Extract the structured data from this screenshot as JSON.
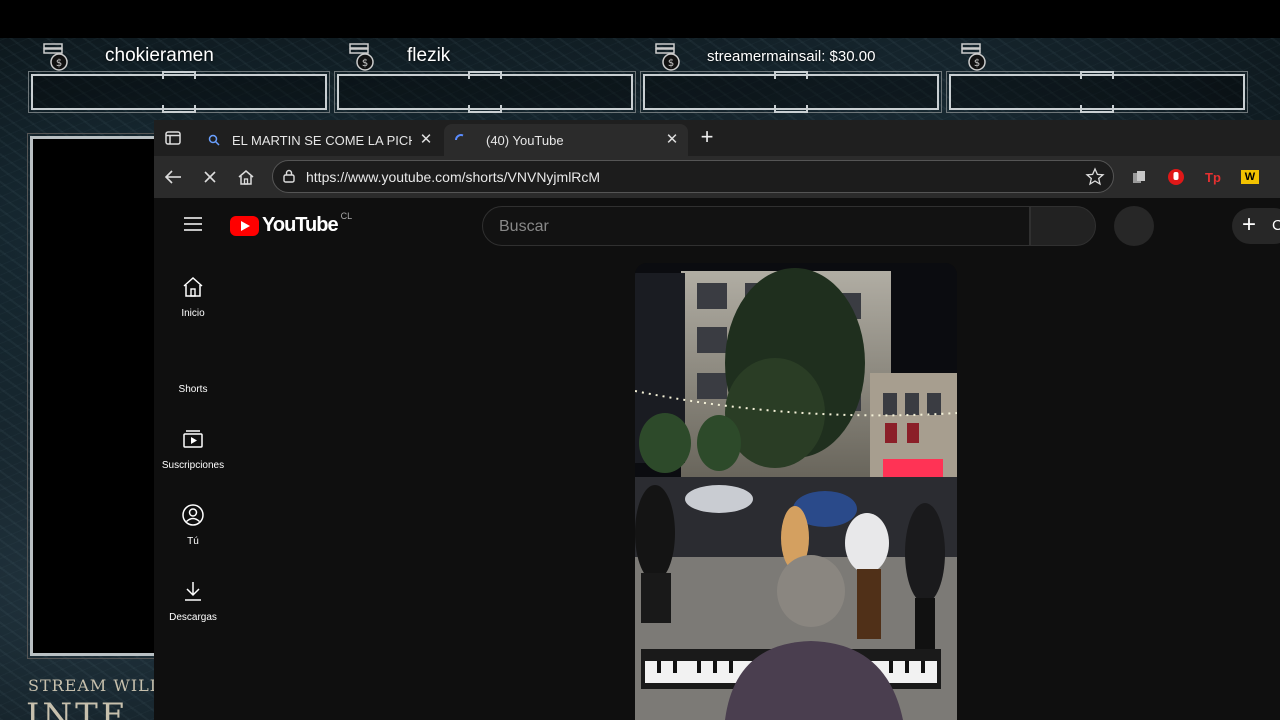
{
  "overlay": {
    "donors": [
      {
        "name": "chokieramen"
      },
      {
        "name": "flezik"
      },
      {
        "name": "streamermainsail: $30.00"
      },
      {
        "name": ""
      }
    ],
    "bottom_text": "STREAM WILL",
    "big_text": "INTE"
  },
  "browser": {
    "tabs": [
      {
        "title": "EL MARTIN SE COME LA PICHULA",
        "close": "✕",
        "favicon": "search-icon"
      },
      {
        "title": "(40) YouTube",
        "close": "✕",
        "favicon": "loading-icon"
      }
    ],
    "new_tab": "+",
    "url": "https://www.youtube.com/shorts/VNVNyjmlRcM",
    "extensions": [
      "copy-icon",
      "hand-icon",
      "tp-icon",
      "w-icon"
    ],
    "ext_tp": "Tp",
    "ext_w": "W"
  },
  "youtube": {
    "logo": "YouTube",
    "region": "CL",
    "search_placeholder": "Buscar",
    "create_label": "C",
    "sidebar": [
      {
        "label": "Inicio",
        "icon": "home-icon"
      },
      {
        "label": "Shorts",
        "icon": "shorts-icon"
      },
      {
        "label": "Suscripciones",
        "icon": "subscriptions-icon"
      },
      {
        "label": "Tú",
        "icon": "user-icon"
      },
      {
        "label": "Descargas",
        "icon": "download-icon"
      }
    ]
  },
  "colors": {
    "yt_red": "#ff0000",
    "bg": "#0f0f0f",
    "tabbar": "#1f1f1f",
    "toolbar": "#2b2b2b"
  }
}
